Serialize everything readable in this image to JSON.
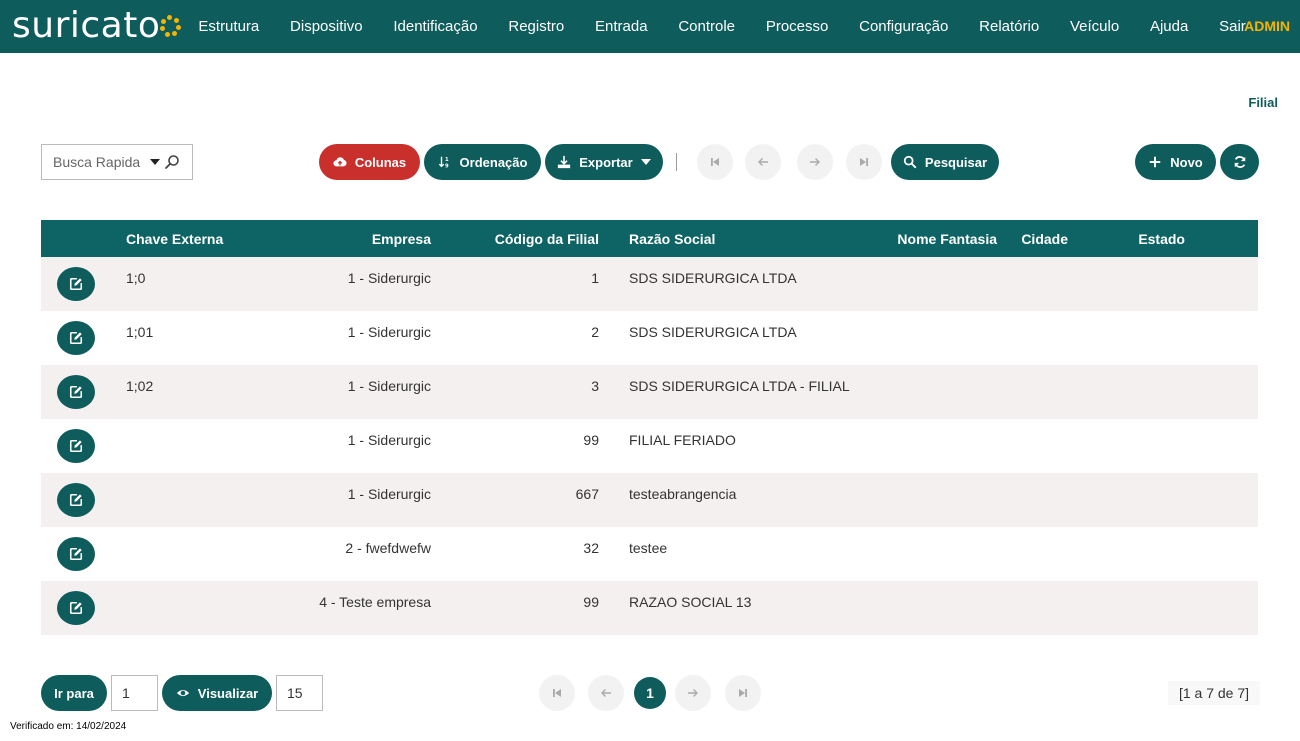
{
  "app": {
    "logo_text": "suricato",
    "nav": [
      "Estrutura",
      "Dispositivo",
      "Identificação",
      "Registro",
      "Entrada",
      "Controle",
      "Processo",
      "Configuração",
      "Relatório",
      "Veículo",
      "Ajuda",
      "Sair"
    ],
    "user": "ADMIN"
  },
  "page": {
    "breadcrumb": "Filial"
  },
  "toolbar": {
    "quick_search_placeholder": "Busca Rapida",
    "columns_label": "Colunas",
    "order_label": "Ordenação",
    "export_label": "Exportar",
    "search_label": "Pesquisar",
    "new_label": "Novo"
  },
  "table": {
    "headers": [
      "",
      "Chave Externa",
      "Empresa",
      "Código da Filial",
      "Razão Social",
      "Nome Fantasia",
      "Cidade",
      "Estado"
    ],
    "rows": [
      [
        "1;0",
        "1 - Siderurgic",
        "1",
        "SDS SIDERURGICA LTDA",
        "",
        "",
        ""
      ],
      [
        "1;01",
        "1 - Siderurgic",
        "2",
        "SDS SIDERURGICA LTDA",
        "",
        "",
        ""
      ],
      [
        "1;02",
        "1 - Siderurgic",
        "3",
        "SDS SIDERURGICA LTDA - FILIAL",
        "",
        "",
        ""
      ],
      [
        "",
        "1 - Siderurgic",
        "99",
        "FILIAL FERIADO",
        "",
        "",
        ""
      ],
      [
        "",
        "1 - Siderurgic",
        "667",
        "testeabrangencia",
        "",
        "",
        ""
      ],
      [
        "",
        "2 - fwefdwefw",
        "32",
        "testee",
        "",
        "",
        ""
      ],
      [
        "",
        "4 - Teste empresa",
        "99",
        "RAZAO SOCIAL 13",
        "",
        "",
        ""
      ]
    ]
  },
  "footer": {
    "goto_label": "Ir para",
    "goto_value": "1",
    "view_label": "Visualizar",
    "view_value": "15",
    "current_page": "1",
    "range_text": "[1 a 7 de 7]",
    "verified_text": "Verificado em: 14/02/2024"
  },
  "colors": {
    "primary": "#0e5c5c",
    "accent": "#f4b400",
    "danger": "#c9302c"
  }
}
